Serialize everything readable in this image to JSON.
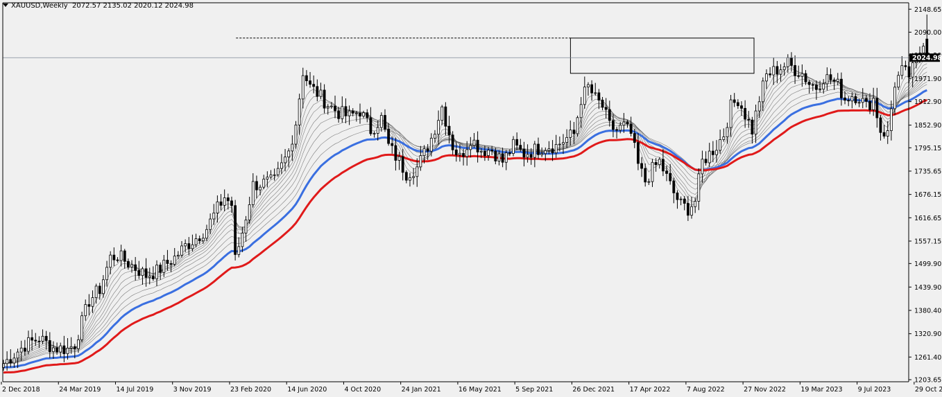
{
  "header": {
    "symbol": "XAUUSD,Weekly",
    "ohlc": "2072.57 2135.02 2020.12 2024.98"
  },
  "colors": {
    "background": "#f0f0f0",
    "bull_body": "#ffffff",
    "bear_body": "#000000",
    "ema_blue": "#3a6fe0",
    "ema_red": "#e01a1a",
    "ribbon": "#555555",
    "price_line": "#7d8896"
  },
  "chart_data": {
    "type": "candlestick",
    "symbol": "XAUUSD",
    "timeframe": "Weekly",
    "last_price": 2024.98,
    "last_price_label": "2024.98",
    "ylim": [
      1203.65,
      2165
    ],
    "yticks": [
      "2148.65",
      "2090.00",
      "2031.20",
      "1971.90",
      "1912.90",
      "1852.90",
      "1795.15",
      "1735.65",
      "1676.15",
      "1616.65",
      "1557.15",
      "1499.90",
      "1439.90",
      "1380.40",
      "1320.90",
      "1261.40",
      "1203.65"
    ],
    "xlabels": [
      "2 Dec 2018",
      "24 Mar 2019",
      "14 Jul 2019",
      "3 Nov 2019",
      "23 Feb 2020",
      "14 Jun 2020",
      "4 Oct 2020",
      "24 Jan 2021",
      "16 May 2021",
      "5 Sep 2021",
      "26 Dec 2021",
      "17 Apr 2022",
      "7 Aug 2022",
      "27 Nov 2022",
      "19 Mar 2023",
      "9 Jul 2023",
      "29 Oct 2023"
    ],
    "xlabel_bar_index": [
      0,
      16,
      32,
      48,
      64,
      80,
      96,
      112,
      128,
      144,
      160,
      176,
      192,
      208,
      224,
      240,
      256
    ],
    "price_anchors": [
      [
        0,
        1245
      ],
      [
        6,
        1292
      ],
      [
        10,
        1310
      ],
      [
        14,
        1285
      ],
      [
        18,
        1282
      ],
      [
        20,
        1295
      ],
      [
        24,
        1405
      ],
      [
        27,
        1435
      ],
      [
        30,
        1515
      ],
      [
        32,
        1520
      ],
      [
        36,
        1495
      ],
      [
        40,
        1470
      ],
      [
        43,
        1480
      ],
      [
        48,
        1515
      ],
      [
        51,
        1545
      ],
      [
        54,
        1565
      ],
      [
        57,
        1590
      ],
      [
        60,
        1640
      ],
      [
        62,
        1670
      ],
      [
        64,
        1650
      ],
      [
        65,
        1510
      ],
      [
        67,
        1580
      ],
      [
        70,
        1700
      ],
      [
        73,
        1705
      ],
      [
        76,
        1710
      ],
      [
        80,
        1785
      ],
      [
        82,
        1860
      ],
      [
        84,
        1990
      ],
      [
        86,
        1950
      ],
      [
        88,
        1935
      ],
      [
        91,
        1905
      ],
      [
        94,
        1885
      ],
      [
        97,
        1875
      ],
      [
        100,
        1890
      ],
      [
        103,
        1840
      ],
      [
        106,
        1870
      ],
      [
        108,
        1800
      ],
      [
        111,
        1760
      ],
      [
        113,
        1730
      ],
      [
        116,
        1745
      ],
      [
        118,
        1780
      ],
      [
        120,
        1820
      ],
      [
        123,
        1900
      ],
      [
        126,
        1800
      ],
      [
        128,
        1770
      ],
      [
        131,
        1820
      ],
      [
        134,
        1790
      ],
      [
        137,
        1790
      ],
      [
        140,
        1760
      ],
      [
        143,
        1800
      ],
      [
        146,
        1780
      ],
      [
        149,
        1790
      ],
      [
        152,
        1800
      ],
      [
        155,
        1800
      ],
      [
        158,
        1820
      ],
      [
        160,
        1830
      ],
      [
        162,
        1920
      ],
      [
        164,
        1950
      ],
      [
        166,
        1920
      ],
      [
        168,
        1900
      ],
      [
        170,
        1850
      ],
      [
        172,
        1840
      ],
      [
        174,
        1850
      ],
      [
        176,
        1830
      ],
      [
        178,
        1750
      ],
      [
        180,
        1710
      ],
      [
        182,
        1740
      ],
      [
        184,
        1760
      ],
      [
        186,
        1720
      ],
      [
        188,
        1680
      ],
      [
        190,
        1650
      ],
      [
        192,
        1640
      ],
      [
        194,
        1660
      ],
      [
        196,
        1760
      ],
      [
        198,
        1780
      ],
      [
        200,
        1800
      ],
      [
        202,
        1830
      ],
      [
        204,
        1900
      ],
      [
        206,
        1920
      ],
      [
        208,
        1880
      ],
      [
        210,
        1840
      ],
      [
        212,
        1920
      ],
      [
        214,
        1980
      ],
      [
        216,
        1990
      ],
      [
        218,
        2000
      ],
      [
        220,
        2010
      ],
      [
        222,
        1995
      ],
      [
        224,
        1985
      ],
      [
        226,
        1960
      ],
      [
        228,
        1950
      ],
      [
        230,
        1975
      ],
      [
        232,
        1970
      ],
      [
        234,
        1955
      ],
      [
        236,
        1920
      ],
      [
        238,
        1930
      ],
      [
        240,
        1925
      ],
      [
        242,
        1900
      ],
      [
        244,
        1920
      ],
      [
        246,
        1840
      ],
      [
        248,
        1830
      ],
      [
        250,
        1960
      ],
      [
        252,
        1990
      ],
      [
        254,
        1980
      ],
      [
        256,
        2010
      ],
      [
        258,
        2070
      ],
      [
        259,
        2030
      ]
    ],
    "ema_blue_offset": -52,
    "ema_red_offset": -65,
    "resistance_level": 2075,
    "zone": {
      "price_high": 2075,
      "price_low": 1985,
      "bar_start": 160,
      "bar_end": 265
    },
    "dashed_line": {
      "price": 2075,
      "bar_start": 73,
      "bar_end": 160
    }
  }
}
